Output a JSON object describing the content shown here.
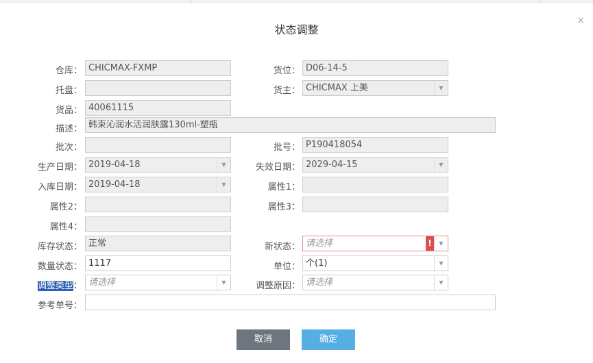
{
  "dialog": {
    "title": "状态调整",
    "close_glyph": "×"
  },
  "colon": "：",
  "dropdown_glyph": "▼",
  "error_glyph": "!",
  "fields": {
    "warehouse": {
      "label": "仓库",
      "value": "CHICMAX-FXMP"
    },
    "location": {
      "label": "货位",
      "value": "D06-14-5"
    },
    "pallet": {
      "label": "托盘",
      "value": ""
    },
    "owner": {
      "label": "货主",
      "value": "CHICMAX 上美"
    },
    "item": {
      "label": "货品",
      "value": "40061115"
    },
    "description": {
      "label": "描述",
      "value": "韩束沁润水活润肤露130ml-塑瓶"
    },
    "batch": {
      "label": "批次",
      "value": ""
    },
    "lot_no": {
      "label": "批号",
      "value": "P190418054"
    },
    "production_date": {
      "label": "生产日期",
      "value": "2019-04-18"
    },
    "expiry_date": {
      "label": "失效日期",
      "value": "2029-04-15"
    },
    "inbound_date": {
      "label": "入库日期",
      "value": "2019-04-18"
    },
    "attr1": {
      "label": "属性1",
      "value": ""
    },
    "attr2": {
      "label": "属性2",
      "value": ""
    },
    "attr3": {
      "label": "属性3",
      "value": ""
    },
    "attr4": {
      "label": "属性4",
      "value": ""
    },
    "stock_status": {
      "label": "库存状态",
      "value": "正常"
    },
    "new_status": {
      "label": "新状态",
      "placeholder": "请选择"
    },
    "qty_status": {
      "label": "数量状态",
      "value": "1117"
    },
    "unit": {
      "label": "单位",
      "value": "个(1)"
    },
    "adjust_type": {
      "label": "调整类型",
      "placeholder": "请选择"
    },
    "adjust_reason": {
      "label": "调整原因",
      "placeholder": "请选择"
    },
    "reference_no": {
      "label": "参考单号",
      "value": ""
    }
  },
  "buttons": {
    "cancel": "取消",
    "ok": "确定"
  },
  "colors": {
    "cancel_button": "#6d767e",
    "ok_button": "#56aee5",
    "error": "#e14d4d"
  }
}
